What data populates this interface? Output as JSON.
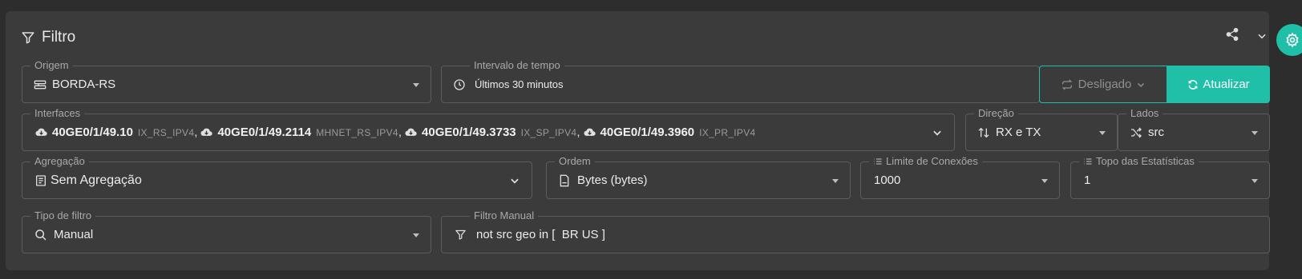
{
  "filter_panel": {
    "title": "Filtro",
    "title_icon": "filter-icon",
    "share_icon": "share-icon",
    "collapse_icon": "chevron-down-icon",
    "settings_icon": "gear-icon",
    "accent_color": "#1fbfa8"
  },
  "origem": {
    "label": "Origem",
    "value": "BORDA-RS",
    "icon": "router-icon"
  },
  "intervalo": {
    "label": "Intervalo de tempo",
    "value": "Últimos 30 minutos",
    "icon": "clock-icon"
  },
  "refresh_mode": {
    "label": "Desligado",
    "icon": "repeat-icon"
  },
  "refresh_button": {
    "label": "Atualizar",
    "icon": "refresh-icon"
  },
  "interfaces": {
    "label": "Interfaces",
    "items": [
      {
        "name": "40GE0/1/49.10",
        "tag": "IX_RS_IPV4"
      },
      {
        "name": "40GE0/1/49.2114",
        "tag": "MHNET_RS_IPV4"
      },
      {
        "name": "40GE0/1/49.3733",
        "tag": "IX_SP_IPV4"
      },
      {
        "name": "40GE0/1/49.3960",
        "tag": "IX_PR_IPV4"
      }
    ],
    "separator": ","
  },
  "direcao": {
    "label": "Direção",
    "value": "RX e TX",
    "icon": "sort-arrows-icon"
  },
  "lados": {
    "label": "Lados",
    "value": "src",
    "icon": "shuffle-icon"
  },
  "agregacao": {
    "label": "Agregação",
    "value": "Sem Agregação",
    "icon": "document-list-icon"
  },
  "ordem": {
    "label": "Ordem",
    "value": "Bytes (bytes)",
    "icon": "file-icon"
  },
  "limite": {
    "label": "Limite de Conexões",
    "value": "1000",
    "icon": "list-icon"
  },
  "topo": {
    "label": "Topo das Estatísticas",
    "value": "1",
    "icon": "list-icon"
  },
  "tipo_filtro": {
    "label": "Tipo de filtro",
    "value": "Manual",
    "icon": "search-icon"
  },
  "filtro_manual": {
    "label": "Filtro Manual",
    "value": "not src geo in [  BR US ]",
    "icon": "filter-icon"
  }
}
